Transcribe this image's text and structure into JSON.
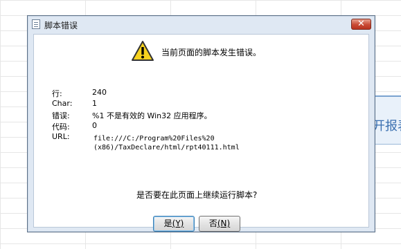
{
  "dialog": {
    "title": "脚本错误",
    "close_label": "✕",
    "message": "当前页面的脚本发生错误。",
    "details": [
      {
        "label": "行:",
        "value": "240"
      },
      {
        "label": "Char:",
        "value": "1"
      },
      {
        "label": "错误:",
        "value": "%1 不是有效的 Win32 应用程序。"
      },
      {
        "label": "代码:",
        "value": "0"
      },
      {
        "label": "URL:",
        "value_line1": "file:///C:/Program%20Files%20",
        "value_line2": "(x86)/TaxDeclare/html/rpt40111.html"
      }
    ],
    "question": "是否要在此页面上继续运行脚本?",
    "buttons": {
      "yes": {
        "label": "是",
        "accel": "(Y)"
      },
      "no": {
        "label": "否",
        "accel": "(N)"
      }
    }
  },
  "background": {
    "panel_text": "开报表"
  },
  "colors": {
    "titlebar": "#dfe8f3",
    "close_button": "#c94a34",
    "warning_yellow": "#f7d21e"
  }
}
